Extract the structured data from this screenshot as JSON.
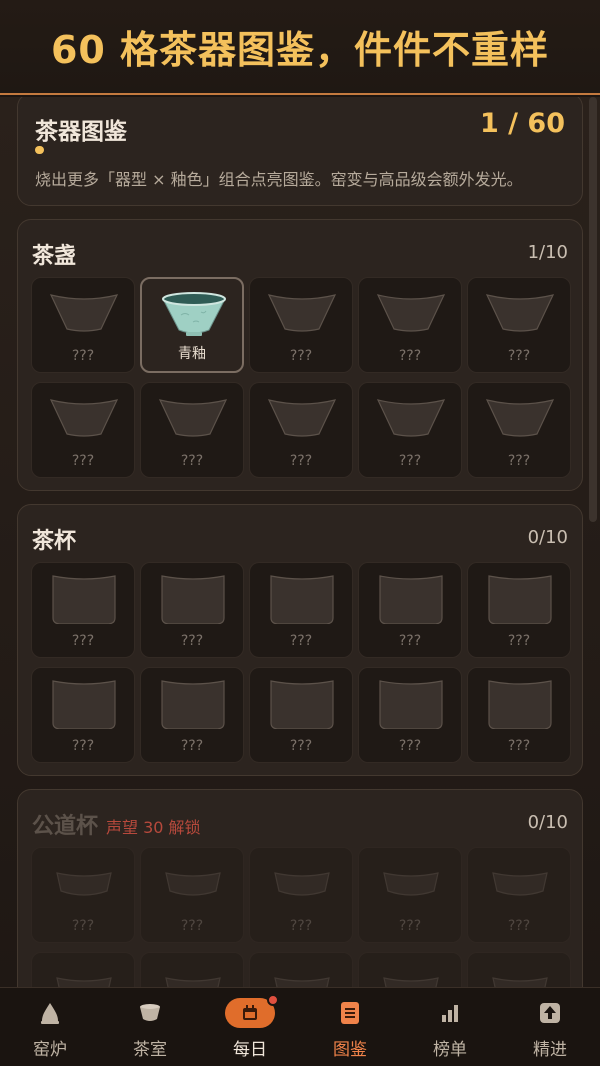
{
  "banner": {
    "text": "60 格茶器图鉴，件件不重样"
  },
  "summary": {
    "title": "茶器图鉴",
    "count": "1 / 60",
    "progress_fraction": 0.0167,
    "description": "烧出更多「器型 × 釉色」组合点亮图鉴。窑变与高品级会额外发光。"
  },
  "categories": [
    {
      "title": "茶盏",
      "count": "1/10",
      "shape": "bowl",
      "locked": false,
      "lock_label": "",
      "cells": [
        {
          "label": "???",
          "found": false
        },
        {
          "label": "青釉",
          "found": true,
          "glaze_color": "#9fd0c4"
        },
        {
          "label": "???",
          "found": false
        },
        {
          "label": "???",
          "found": false
        },
        {
          "label": "???",
          "found": false
        },
        {
          "label": "???",
          "found": false
        },
        {
          "label": "???",
          "found": false
        },
        {
          "label": "???",
          "found": false
        },
        {
          "label": "???",
          "found": false
        },
        {
          "label": "???",
          "found": false
        }
      ]
    },
    {
      "title": "茶杯",
      "count": "0/10",
      "shape": "cup",
      "locked": false,
      "lock_label": "",
      "cells": [
        {
          "label": "???",
          "found": false
        },
        {
          "label": "???",
          "found": false
        },
        {
          "label": "???",
          "found": false
        },
        {
          "label": "???",
          "found": false
        },
        {
          "label": "???",
          "found": false
        },
        {
          "label": "???",
          "found": false
        },
        {
          "label": "???",
          "found": false
        },
        {
          "label": "???",
          "found": false
        },
        {
          "label": "???",
          "found": false
        },
        {
          "label": "???",
          "found": false
        }
      ]
    },
    {
      "title": "公道杯",
      "count": "0/10",
      "shape": "pitcher",
      "locked": true,
      "lock_label": "声望 30 解锁",
      "cells": [
        {
          "label": "???",
          "found": false
        },
        {
          "label": "???",
          "found": false
        },
        {
          "label": "???",
          "found": false
        },
        {
          "label": "???",
          "found": false
        },
        {
          "label": "???",
          "found": false
        },
        {
          "label": "???",
          "found": false
        },
        {
          "label": "???",
          "found": false
        },
        {
          "label": "???",
          "found": false
        },
        {
          "label": "???",
          "found": false
        },
        {
          "label": "???",
          "found": false
        }
      ]
    }
  ],
  "nav": {
    "items": [
      {
        "label": "窑炉",
        "icon": "kiln-icon"
      },
      {
        "label": "茶室",
        "icon": "teabowl-icon"
      },
      {
        "label": "每日",
        "icon": "calendar-icon",
        "badge": true
      },
      {
        "label": "图鉴",
        "icon": "catalog-icon",
        "active": true
      },
      {
        "label": "榜单",
        "icon": "ranking-icon"
      },
      {
        "label": "精进",
        "icon": "upgrade-icon"
      }
    ]
  },
  "colors": {
    "accent": "#f4c15c",
    "active_nav": "#f0834a",
    "daily_pill": "#e06d2b",
    "lock_label": "#b7493c"
  }
}
